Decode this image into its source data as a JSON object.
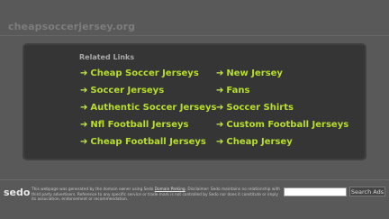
{
  "header": {
    "domain": "cheapsoccerjersey.org"
  },
  "panel": {
    "heading": "Related Links",
    "left_links": [
      "Cheap Soccer Jerseys",
      "Soccer Jerseys",
      "Authentic Soccer Jerseys",
      "Nfl Football Jerseys",
      "Cheap Football Jerseys"
    ],
    "right_links": [
      "New Jersey",
      "Fans",
      "Soccer Shirts",
      "Custom Football Jerseys",
      "Cheap Jersey"
    ],
    "arrow": "➔"
  },
  "footer": {
    "logo": "sedo",
    "disclaimer_pre": "This webpage was generated by the domain owner using Sedo ",
    "disclaimer_link": "Domain Parking",
    "disclaimer_post": ". Disclaimer: Sedo maintains no relationship with third party advertisers. Reference to any specific service or trade mark is not controlled by Sedo nor does it constitute or imply its association, endorsement or recommendation.",
    "search_button": "Search Ads",
    "search_placeholder": ""
  },
  "colors": {
    "background": "#595959",
    "panel": "#353535",
    "link": "#b7de2a",
    "heading": "#a9a9a9"
  }
}
